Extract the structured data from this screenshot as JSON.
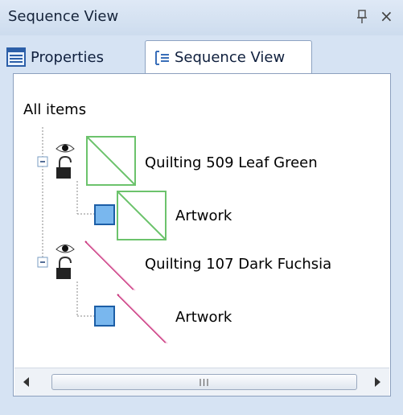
{
  "title_bar": {
    "title": "Sequence View",
    "pin_icon": "pin-icon",
    "close_label": "×"
  },
  "tabs": [
    {
      "label": "Properties",
      "icon": "properties-icon",
      "active": false
    },
    {
      "label": "Sequence View",
      "icon": "sequence-view-icon",
      "active": true
    }
  ],
  "tree": {
    "root_label": "All items",
    "groups": [
      {
        "label": "Quilting 509 Leaf Green",
        "color": "#6cc36c",
        "children": [
          {
            "label": "Artwork",
            "color": "#6cc36c"
          }
        ]
      },
      {
        "label": "Quilting 107 Dark Fuchsia",
        "color": "#c7337a",
        "children": [
          {
            "label": "Artwork",
            "color": "#c7337a"
          }
        ]
      }
    ]
  },
  "scrollbar": {
    "grip": "III"
  }
}
